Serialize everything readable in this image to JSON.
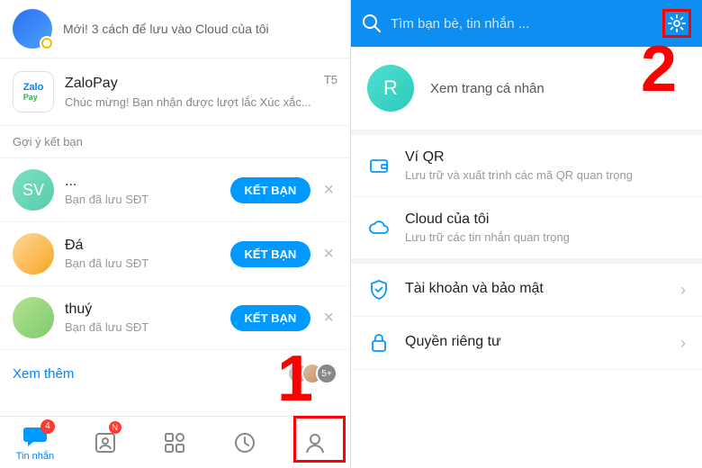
{
  "left": {
    "cloud_row": "Mới! 3 cách để lưu vào Cloud của tôi",
    "zalopay": {
      "icon_top": "Zalo",
      "icon_bottom": "Pay",
      "title": "ZaloPay",
      "subtitle": "Chúc mừng! Bạn nhận được lượt lắc Xúc xắc...",
      "time": "T5"
    },
    "suggest_header": "Gợi ý kết bạn",
    "friends": [
      {
        "initials": "SV",
        "name": "...",
        "sub": "Bạn đã lưu SĐT",
        "btn": "KẾT BẠN"
      },
      {
        "initials": "",
        "name": "Đá",
        "sub": "Bạn đã lưu SĐT",
        "btn": "KẾT BẠN"
      },
      {
        "initials": "",
        "name": "thuý",
        "sub": "Bạn đã lưu SĐT",
        "btn": "KẾT BẠN"
      }
    ],
    "more": "Xem thêm",
    "more_count": "5+",
    "nav": {
      "messages_label": "Tin nhắn",
      "messages_badge": "4",
      "contacts_badge": "N"
    }
  },
  "right": {
    "search_placeholder": "Tìm bạn bè, tin nhắn ...",
    "profile": {
      "initial": "R",
      "label": "Xem trang cá nhân"
    },
    "menu": [
      {
        "title": "Ví QR",
        "sub": "Lưu trữ và xuất trình các mã QR quan trọng"
      },
      {
        "title": "Cloud của tôi",
        "sub": "Lưu trữ các tin nhắn quan trọng"
      },
      {
        "title": "Tài khoản và bảo mật",
        "sub": ""
      },
      {
        "title": "Quyền riêng tư",
        "sub": ""
      }
    ]
  },
  "annotations": {
    "one": "1",
    "two": "2"
  }
}
